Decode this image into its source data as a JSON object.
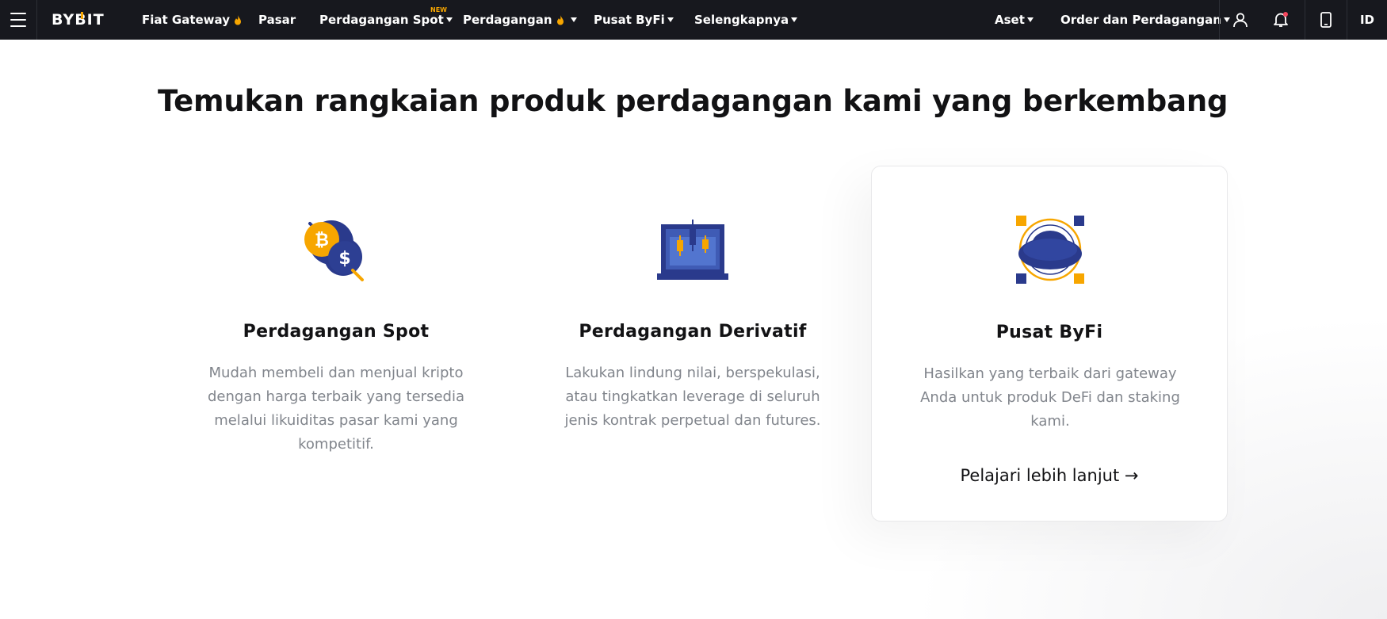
{
  "header": {
    "logo": "BYBIT",
    "nav": [
      {
        "label": "Fiat Gateway"
      },
      {
        "label": "Pasar"
      },
      {
        "label": "Perdagangan Spot",
        "badge": "NEW"
      },
      {
        "label": "Perdagangan"
      },
      {
        "label": "Pusat ByFi"
      },
      {
        "label": "Selengkapnya"
      }
    ],
    "right_nav": [
      {
        "label": "Aset"
      },
      {
        "label": "Order dan Perdagangan"
      }
    ],
    "language": "ID",
    "icons": [
      "menu-icon",
      "user-icon",
      "bell-icon",
      "mobile-icon"
    ],
    "accent_color": "#f7a600",
    "bg_color": "#17181e"
  },
  "main": {
    "title": "Temukan rangkaian produk perdagangan kami yang berkembang",
    "cards": [
      {
        "icon": "spot-coins-icon",
        "title": "Perdagangan Spot",
        "desc": "Mudah membeli dan menjual kripto dengan harga terbaik yang tersedia melalui likuiditas pasar kami yang kompetitif."
      },
      {
        "icon": "derivatives-candles-icon",
        "title": "Perdagangan Derivatif",
        "desc": "Lakukan lindung nilai, berspekulasi, atau tingkatkan leverage di seluruh jenis kontrak perpetual dan futures."
      },
      {
        "icon": "byfi-cloud-icon",
        "title": "Pusat ByFi",
        "desc": "Hasilkan yang terbaik dari gateway Anda untuk produk DeFi dan staking kami.",
        "link": "Pelajari lebih lanjut →"
      }
    ]
  }
}
